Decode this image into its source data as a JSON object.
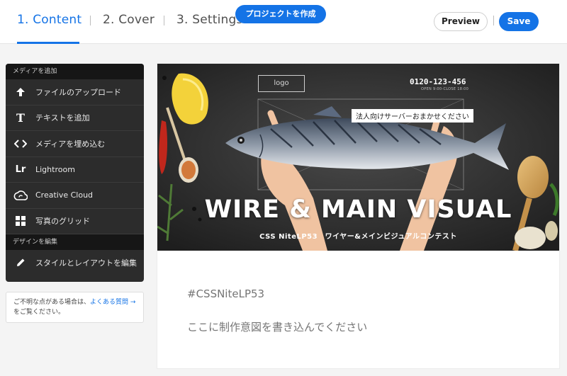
{
  "header": {
    "tabs": [
      {
        "label": "1. Content",
        "active": true
      },
      {
        "label": "2. Cover",
        "active": false
      },
      {
        "label": "3. Settings",
        "active": false
      }
    ],
    "create_project_label": "プロジェクトを作成",
    "preview_label": "Preview",
    "save_label": "Save"
  },
  "sidebar": {
    "media_section_title": "メディアを追加",
    "media_items": [
      {
        "label": "ファイルのアップロード",
        "icon": "upload-arrow-icon"
      },
      {
        "label": "テキストを追加",
        "icon": "text-t-icon"
      },
      {
        "label": "メディアを埋め込む",
        "icon": "embed-code-icon"
      },
      {
        "label": "Lightroom",
        "icon": "lightroom-icon"
      },
      {
        "label": "Creative Cloud",
        "icon": "creative-cloud-icon"
      },
      {
        "label": "写真のグリッド",
        "icon": "photo-grid-icon"
      }
    ],
    "design_section_title": "デザインを編集",
    "design_items": [
      {
        "label": "スタイルとレイアウトを編集",
        "icon": "pencil-icon"
      }
    ],
    "icon_text": {
      "text": "T",
      "lightroom": "Lr"
    }
  },
  "help": {
    "prefix": "ご不明な点がある場合は、",
    "link": "よくある質問 →",
    "suffix": "をご覧ください。"
  },
  "banner": {
    "logo": "logo",
    "phone": "0120-123-456",
    "hours": "OPEN 9:00-CLOSE 18:00",
    "tagline": "法人向けサーバーおまかせください",
    "title": "WIRE & MAIN VISUAL",
    "subtitle": "CSS NiteLP53　ワイヤー&メインビジュアルコンテスト"
  },
  "description": {
    "hashtag": "#CSSNiteLP53",
    "body": "ここに制作意図を書き込んでください"
  },
  "colors": {
    "accent": "#1473e6",
    "panel_bg": "#2c2c2c",
    "panel_head_bg": "#161616"
  }
}
